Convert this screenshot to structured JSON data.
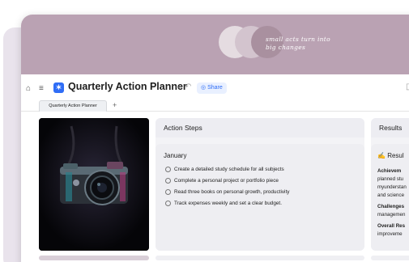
{
  "banner": {
    "quote_line1": "small acts turn into",
    "quote_line2": "big changes"
  },
  "toolbar": {
    "home_icon": "home-icon",
    "menu_icon": "menu-icon",
    "app_icon": "app-logo-icon",
    "title": "Quarterly Action Planner",
    "more_label": "⋯",
    "undo_icon": "undo-icon",
    "share_label": "Share"
  },
  "tabs": {
    "items": [
      {
        "label": "Quarterly Action Planner"
      }
    ],
    "add_label": "+"
  },
  "action_steps": {
    "heading": "Action Steps",
    "month": "January",
    "tasks": [
      "Create a detailed study schedule for all subjects",
      "Complete a personal project or portfolio piece",
      "Read three books on personal growth, productivity",
      "Track expenses weekly and set a clear budget."
    ]
  },
  "results": {
    "heading": "Results",
    "emoji": "✍️",
    "sub_heading": "Resul",
    "lines": [
      {
        "text": "Achievem",
        "bold": true
      },
      {
        "text": "planned stu",
        "bold": false
      },
      {
        "text": "myunderstan",
        "bold": false
      },
      {
        "text": "and science",
        "bold": false
      },
      {
        "text": "Challenges",
        "bold": true
      },
      {
        "text": "managemen",
        "bold": false
      },
      {
        "text": "Overall Res",
        "bold": true
      },
      {
        "text": "improveme",
        "bold": false
      }
    ]
  },
  "colors": {
    "banner": "#baa2b3",
    "accent": "#2f6df6"
  }
}
